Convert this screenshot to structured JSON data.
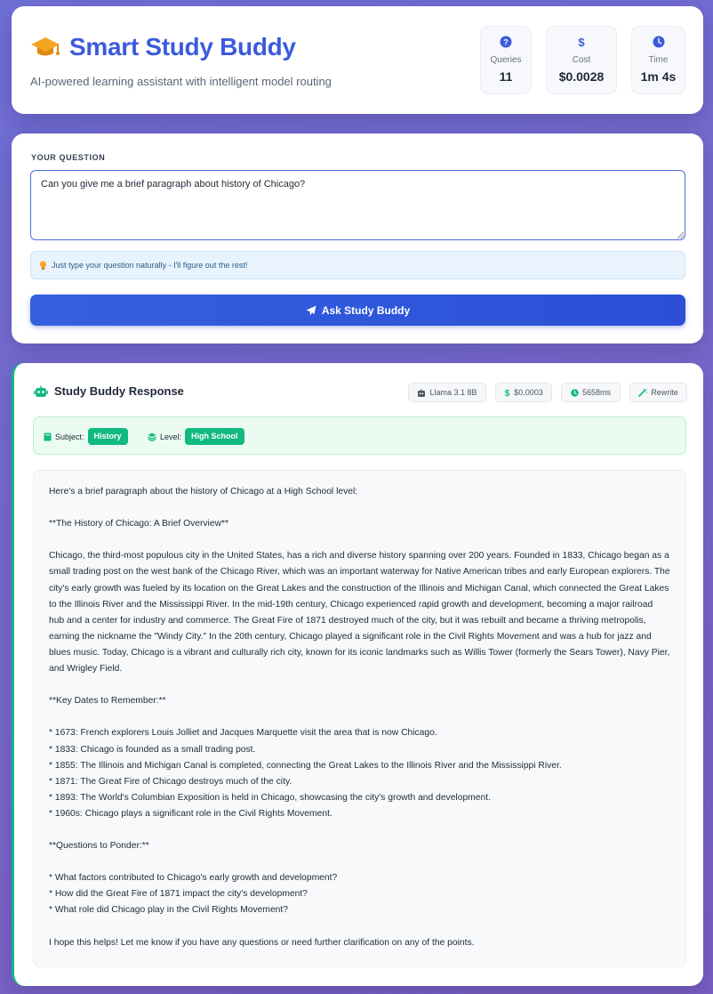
{
  "header": {
    "title": "Smart Study Buddy",
    "subtitle": "AI-powered learning assistant with intelligent model routing",
    "stats": [
      {
        "icon": "question-circle-icon",
        "label": "Queries",
        "value": "11"
      },
      {
        "icon": "dollar-icon",
        "label": "Cost",
        "value": "$0.0028"
      },
      {
        "icon": "clock-icon",
        "label": "Time",
        "value": "1m 4s"
      }
    ]
  },
  "ask": {
    "label": "YOUR QUESTION",
    "question": "Can you give me a brief paragraph about history of Chicago?",
    "hint": "Just type your question naturally - I'll figure out the rest!",
    "button": "Ask Study Buddy"
  },
  "response": {
    "title": "Study Buddy Response",
    "chips": {
      "model": "Llama 3.1 8B",
      "cost": "$0.0003",
      "time": "5658ms",
      "rewrite": "Rewrite"
    },
    "meta": {
      "subject_label": "Subject:",
      "subject": "History",
      "level_label": "Level:",
      "level": "High School"
    },
    "intro": "Here's a brief paragraph about the history of Chicago at a High School level:",
    "overview_heading": "**The History of Chicago: A Brief Overview**",
    "paragraph": "Chicago, the third-most populous city in the United States, has a rich and diverse history spanning over 200 years. Founded in 1833, Chicago began as a small trading post on the west bank of the Chicago River, which was an important waterway for Native American tribes and early European explorers. The city's early growth was fueled by its location on the Great Lakes and the construction of the Illinois and Michigan Canal, which connected the Great Lakes to the Illinois River and the Mississippi River. In the mid-19th century, Chicago experienced rapid growth and development, becoming a major railroad hub and a center for industry and commerce. The Great Fire of 1871 destroyed much of the city, but it was rebuilt and became a thriving metropolis, earning the nickname the \"Windy City.\" In the 20th century, Chicago played a significant role in the Civil Rights Movement and was a hub for jazz and blues music. Today, Chicago is a vibrant and culturally rich city, known for its iconic landmarks such as Willis Tower (formerly the Sears Tower), Navy Pier, and Wrigley Field.",
    "dates_heading": "**Key Dates to Remember:**",
    "dates": [
      "* 1673: French explorers Louis Jolliet and Jacques Marquette visit the area that is now Chicago.",
      "* 1833: Chicago is founded as a small trading post.",
      "* 1855: The Illinois and Michigan Canal is completed, connecting the Great Lakes to the Illinois River and the Mississippi River.",
      "* 1871: The Great Fire of Chicago destroys much of the city.",
      "* 1893: The World's Columbian Exposition is held in Chicago, showcasing the city's growth and development.",
      "* 1960s: Chicago plays a significant role in the Civil Rights Movement."
    ],
    "questions_heading": "**Questions to Ponder:**",
    "questions": [
      "* What factors contributed to Chicago's early growth and development?",
      "* How did the Great Fire of 1871 impact the city's development?",
      "* What role did Chicago play in the Civil Rights Movement?"
    ],
    "closing": "I hope this helps! Let me know if you have any questions or need further clarification on any of the points."
  },
  "colors": {
    "brand": "#3b5bdb",
    "accent_green": "#10b981",
    "button": "#2f56dc"
  }
}
